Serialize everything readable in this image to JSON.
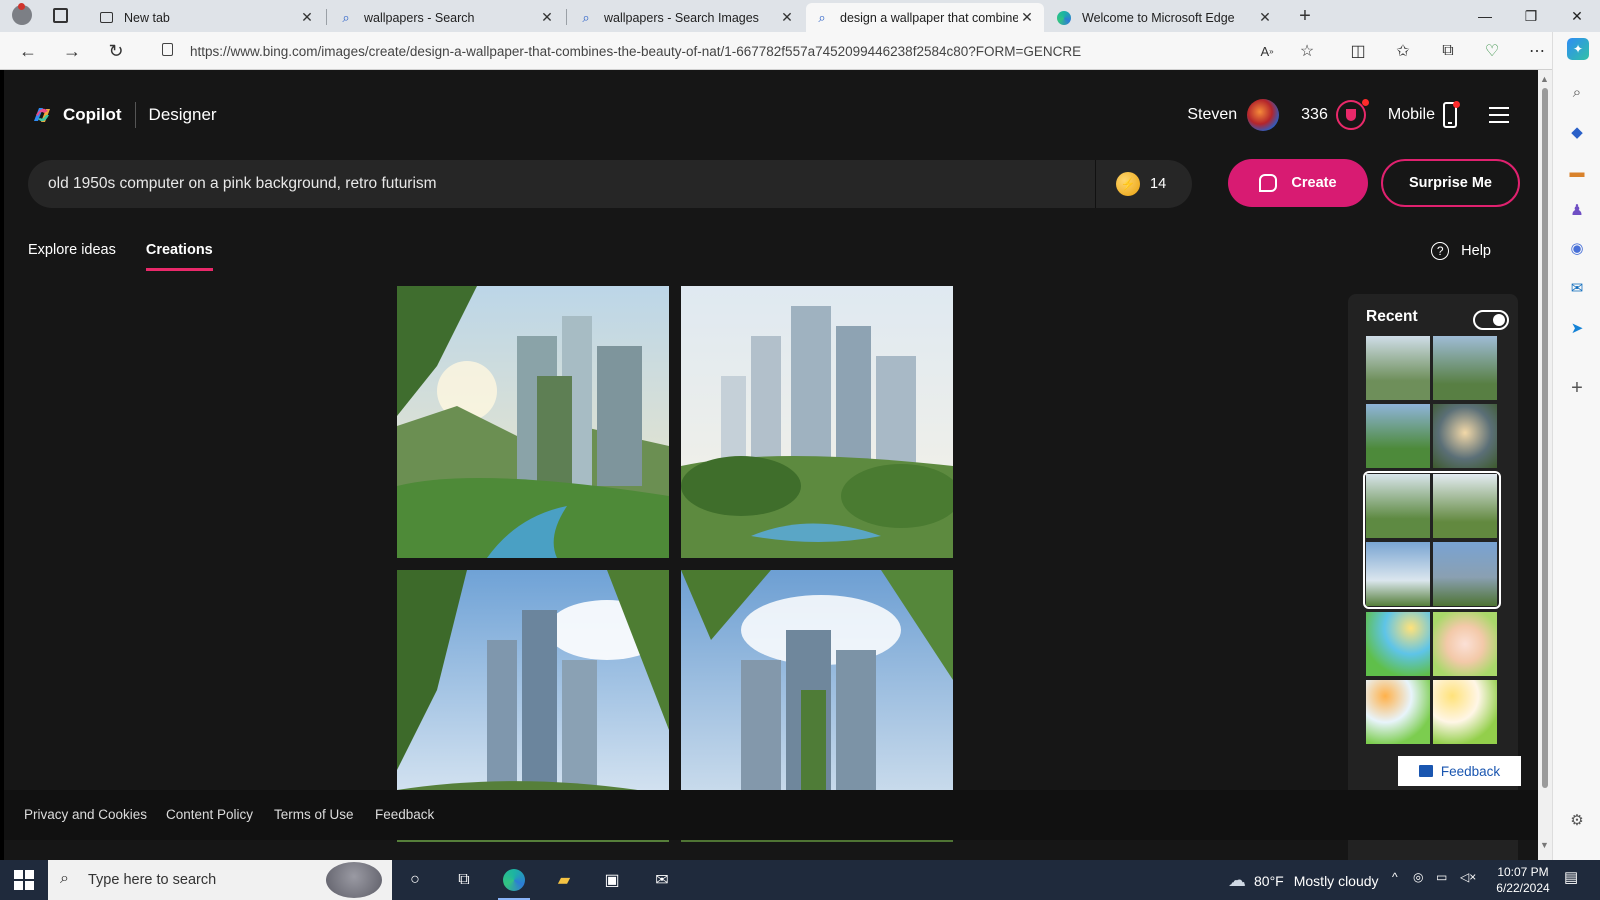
{
  "browser": {
    "tabs": [
      {
        "title": "New tab",
        "icon": "new-tab-icon"
      },
      {
        "title": "wallpapers - Search",
        "icon": "search-icon"
      },
      {
        "title": "wallpapers - Search Images",
        "icon": "search-icon"
      },
      {
        "title": "design a wallpaper that combine",
        "icon": "search-icon",
        "active": true
      },
      {
        "title": "Welcome to Microsoft Edge",
        "icon": "edge-icon"
      }
    ],
    "url": "https://www.bing.com/images/create/design-a-wallpaper-that-combines-the-beauty-of-nat/1-667782f557a7452099446238f2584c80?FORM=GENCRE"
  },
  "header": {
    "brand": "Copilot",
    "product": "Designer",
    "user_name": "Steven",
    "points": "336",
    "mobile_label": "Mobile"
  },
  "prompt": {
    "value": "old 1950s computer on a pink background, retro futurism",
    "boosts": "14"
  },
  "actions": {
    "create_label": "Create",
    "surprise_label": "Surprise Me"
  },
  "page_tabs": [
    {
      "label": "Explore ideas",
      "active": false
    },
    {
      "label": "Creations",
      "active": true
    }
  ],
  "help_label": "Help",
  "recent": {
    "title": "Recent",
    "toggle_on": true
  },
  "footer": {
    "links": [
      "Privacy and Cookies",
      "Content Policy",
      "Terms of Use",
      "Feedback"
    ],
    "feedback_button": "Feedback"
  },
  "taskbar": {
    "search_placeholder": "Type here to search",
    "weather_temp": "80°F",
    "weather_text": "Mostly cloudy",
    "time": "10:07 PM",
    "date": "6/22/2024"
  },
  "colors": {
    "accent": "#d81b72",
    "page_bg": "#161616"
  }
}
